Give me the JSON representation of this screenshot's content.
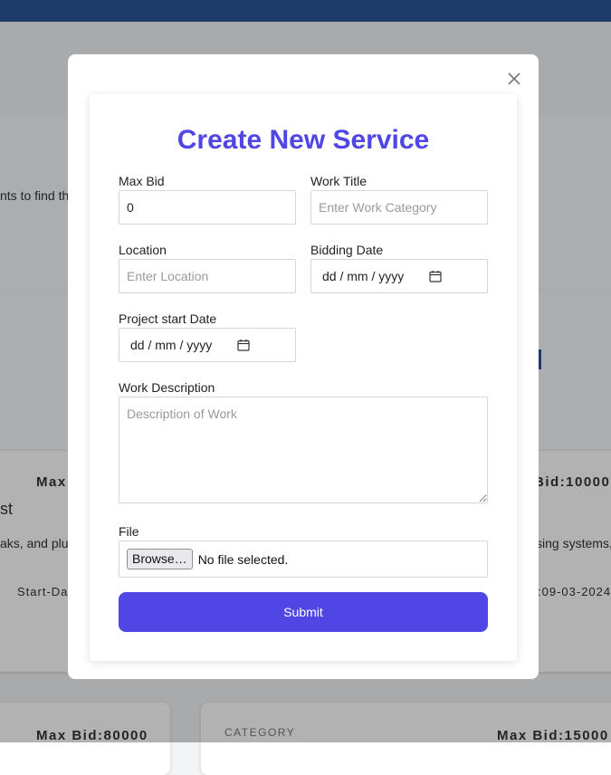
{
  "background": {
    "line1": "nts to find th",
    "card1_max_bid": "Max B",
    "card2_max_bid": "Bid:10000",
    "card1_title": "st",
    "card1_desc": "aks, and plur",
    "card2_desc": "sing systems,",
    "card1_start": "Start-Dat",
    "card2_start": ":09-03-2024",
    "card3_max_bid": "Max Bid:80000",
    "card4_category": "CATEGORY",
    "card4_max_bid": "Max Bid:15000"
  },
  "modal": {
    "title": "Create New Service",
    "close_glyph": "×",
    "fields": {
      "max_bid_label": "Max Bid",
      "max_bid_value": "0",
      "work_title_label": "Work Title",
      "work_title_placeholder": "Enter Work Category",
      "location_label": "Location",
      "location_placeholder": "Enter Location",
      "bidding_date_label": "Bidding Date",
      "bidding_date_value": "dd / mm / yyyy",
      "project_start_label": "Project start Date",
      "project_start_value": "dd / mm / yyyy",
      "description_label": "Work Description",
      "description_placeholder": "Description of Work",
      "file_label": "File",
      "browse_label": "Browse…",
      "file_status": "No file selected."
    },
    "submit_label": "Submit"
  },
  "colors": {
    "accent": "#4f46e5",
    "topbar": "#2b5797"
  },
  "icons": [
    "close-icon",
    "calendar-icon"
  ]
}
